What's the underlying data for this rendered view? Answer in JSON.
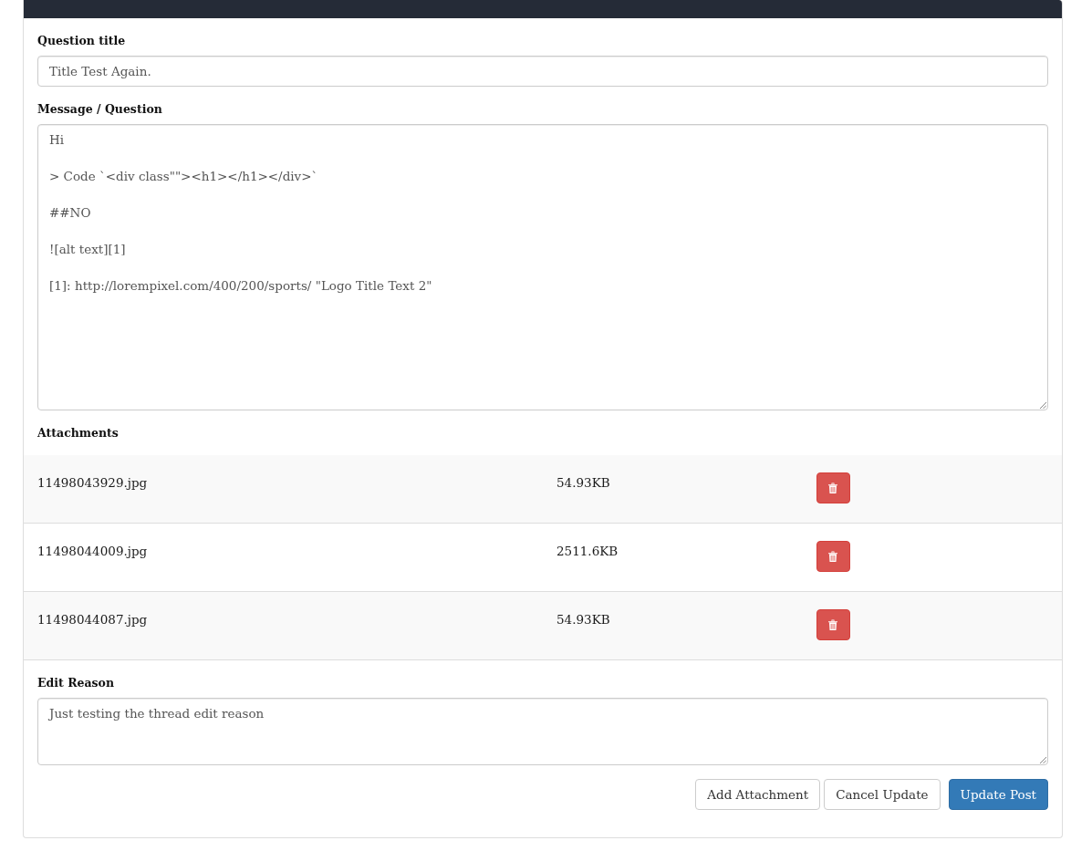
{
  "question_title": {
    "label": "Question title",
    "value": "Title Test Again."
  },
  "message": {
    "label": "Message / Question",
    "value": "Hi\n\n> Code `<div class\"\"><h1></h1></div>`\n\n##NO\n\n![alt text][1]\n\n[1]: http://lorempixel.com/400/200/sports/ \"Logo Title Text 2\""
  },
  "attachments": {
    "label": "Attachments",
    "rows": [
      {
        "file": "11498043929.jpg",
        "size": "54.93KB"
      },
      {
        "file": "11498044009.jpg",
        "size": "2511.6KB"
      },
      {
        "file": "11498044087.jpg",
        "size": "54.93KB"
      }
    ]
  },
  "edit_reason": {
    "label": "Edit Reason",
    "value": "Just testing the thread edit reason"
  },
  "buttons": [
    {
      "label": "Add Attachment",
      "kind": "default"
    },
    {
      "label": "Cancel Update",
      "kind": "default"
    },
    {
      "label": "Update Post",
      "kind": "primary"
    }
  ]
}
